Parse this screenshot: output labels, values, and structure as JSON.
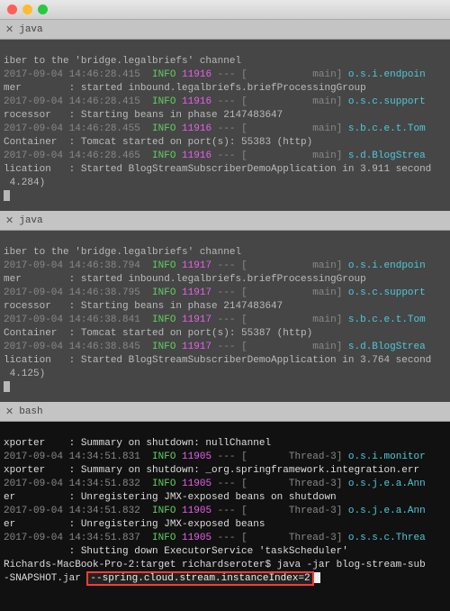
{
  "titlebar": {
    "tabs": [
      "java",
      "java",
      "bash"
    ]
  },
  "pane1": {
    "tab": "java",
    "l0": "iber to the 'bridge.legalbriefs' channel",
    "l1_ts": "2017-09-04 14:46:28.415",
    "l1_info": "INFO",
    "l1_pid": "11916",
    "l1_dash": " --- [",
    "l1_th": "           main",
    "l1_br": "] ",
    "l1_lg": "o.s.i.endpoin",
    "l2_a": "mer        : started inbound.legalbriefs.briefProcessingGroup",
    "l3_ts": "2017-09-04 14:46:28.415",
    "l3_info": "INFO",
    "l3_pid": "11916",
    "l3_dash": " --- [",
    "l3_th": "           main",
    "l3_br": "] ",
    "l3_lg": "o.s.c.support",
    "l4_a": "rocessor   : Starting beans in phase 2147483647",
    "l5_ts": "2017-09-04 14:46:28.455",
    "l5_info": "INFO",
    "l5_pid": "11916",
    "l5_dash": " --- [",
    "l5_th": "           main",
    "l5_br": "] ",
    "l5_lg": "s.b.c.e.t.Tom",
    "l6_a": "Container  : Tomcat started on port(s): 55383 (http)",
    "l7_ts": "2017-09-04 14:46:28.465",
    "l7_info": "INFO",
    "l7_pid": "11916",
    "l7_dash": " --- [",
    "l7_th": "           main",
    "l7_br": "] ",
    "l7_lg": "s.d.BlogStrea",
    "l8_a": "lication   : Started BlogStreamSubscriberDemoApplication in 3.911 second",
    "l9_a": " 4.284)"
  },
  "pane2": {
    "tab": "java",
    "l0": "iber to the 'bridge.legalbriefs' channel",
    "l1_ts": "2017-09-04 14:46:38.794",
    "l1_info": "INFO",
    "l1_pid": "11917",
    "l1_dash": " --- [",
    "l1_th": "           main",
    "l1_br": "] ",
    "l1_lg": "o.s.i.endpoin",
    "l2_a": "mer        : started inbound.legalbriefs.briefProcessingGroup",
    "l3_ts": "2017-09-04 14:46:38.795",
    "l3_info": "INFO",
    "l3_pid": "11917",
    "l3_dash": " --- [",
    "l3_th": "           main",
    "l3_br": "] ",
    "l3_lg": "o.s.c.support",
    "l4_a": "rocessor   : Starting beans in phase 2147483647",
    "l5_ts": "2017-09-04 14:46:38.841",
    "l5_info": "INFO",
    "l5_pid": "11917",
    "l5_dash": " --- [",
    "l5_th": "           main",
    "l5_br": "] ",
    "l5_lg": "s.b.c.e.t.Tom",
    "l6_a": "Container  : Tomcat started on port(s): 55387 (http)",
    "l7_ts": "2017-09-04 14:46:38.845",
    "l7_info": "INFO",
    "l7_pid": "11917",
    "l7_dash": " --- [",
    "l7_th": "           main",
    "l7_br": "] ",
    "l7_lg": "s.d.BlogStrea",
    "l8_a": "lication   : Started BlogStreamSubscriberDemoApplication in 3.764 second",
    "l9_a": " 4.125)"
  },
  "pane3": {
    "tab": "bash",
    "l1_a": "xporter    : Summary on shutdown: nullChannel",
    "l2_ts": "2017-09-04 14:34:51.831",
    "l2_info": "INFO",
    "l2_pid": "11905",
    "l2_dash": " --- [",
    "l2_th": "       Thread-3",
    "l2_br": "] ",
    "l2_lg": "o.s.i.monitor",
    "l3_a": "xporter    : Summary on shutdown: _org.springframework.integration.err",
    "l4_ts": "2017-09-04 14:34:51.832",
    "l4_info": "INFO",
    "l4_pid": "11905",
    "l4_dash": " --- [",
    "l4_th": "       Thread-3",
    "l4_br": "] ",
    "l4_lg": "o.s.j.e.a.Ann",
    "l5_a": "er         : Unregistering JMX-exposed beans on shutdown",
    "l6_ts": "2017-09-04 14:34:51.832",
    "l6_info": "INFO",
    "l6_pid": "11905",
    "l6_dash": " --- [",
    "l6_th": "       Thread-3",
    "l6_br": "] ",
    "l6_lg": "o.s.j.e.a.Ann",
    "l7_a": "er         : Unregistering JMX-exposed beans",
    "l8_ts": "2017-09-04 14:34:51.837",
    "l8_info": "INFO",
    "l8_pid": "11905",
    "l8_dash": " --- [",
    "l8_th": "       Thread-3",
    "l8_br": "] ",
    "l8_lg": "o.s.s.c.Threa",
    "l9_a": "           : Shutting down ExecutorService 'taskScheduler'",
    "prompt": "Richards-MacBook-Pro-2:target richardseroter$ ",
    "cmd": "java -jar blog-stream-sub",
    "cmd2a": "-SNAPSHOT.jar ",
    "cmd2b": "--spring.cloud.stream.instanceIndex=2"
  }
}
